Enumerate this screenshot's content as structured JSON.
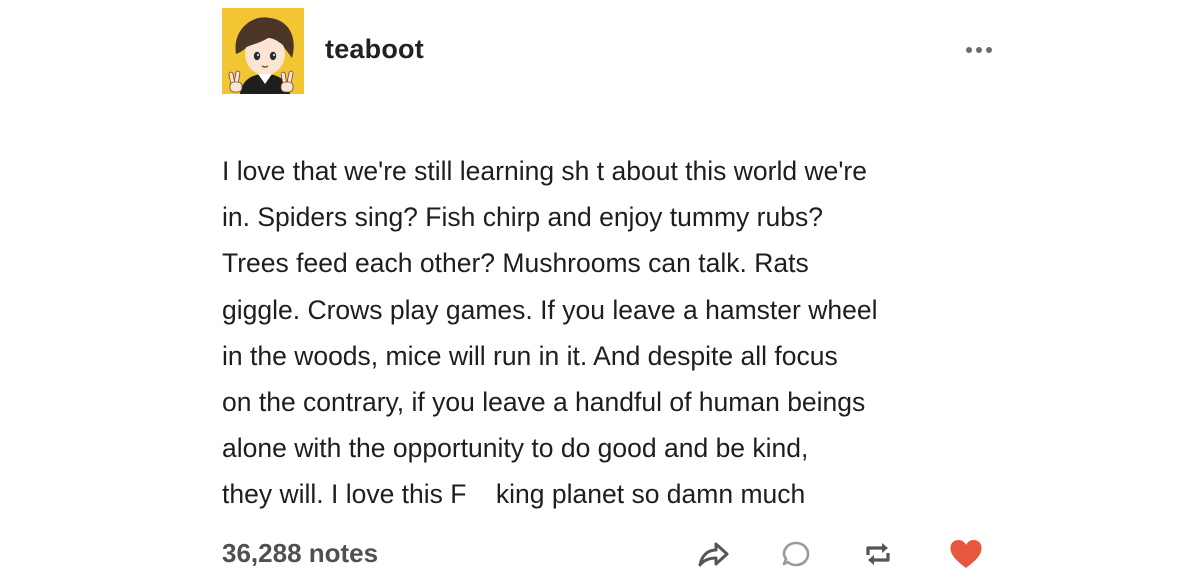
{
  "post": {
    "username": "teaboot",
    "body_lines": [
      "I love that we're still learning sh t about this world we're",
      "in. Spiders sing? Fish chirp and enjoy tummy rubs?",
      "Trees feed each other? Mushrooms can talk. Rats",
      "giggle. Crows play games. If you leave a hamster wheel",
      "in the woods, mice will run in it. And despite all focus",
      "on the contrary, if you leave a handful of human beings",
      "alone with the opportunity to do good and be kind,",
      "they will. I love this F    king planet so damn much"
    ],
    "notes": "36,288 notes",
    "liked": true
  },
  "icons": {
    "avatar": "illustrated-character-avatar",
    "more": "more-options-icon",
    "share": "share-icon",
    "reply": "reply-icon",
    "reblog": "reblog-icon",
    "like": "heart-icon"
  },
  "colors": {
    "avatar_background": "#f2c532",
    "like_active": "#e8563f",
    "icon_gray": "#555555",
    "notes_text": "#505050"
  }
}
